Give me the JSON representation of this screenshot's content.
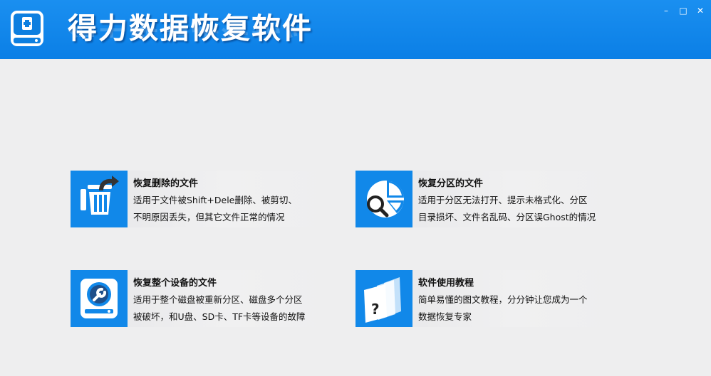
{
  "app": {
    "title": "得力数据恢复软件",
    "colors": {
      "header": "#0b7fe6",
      "icon_bg": "#1188e9",
      "background": "#eeeeef"
    }
  },
  "window_controls": {
    "minimize": "–",
    "maximize": "□",
    "close": "✕"
  },
  "options": [
    {
      "title": "恢复删除的文件",
      "desc_line1": "适用于文件被Shift+Dele删除、被剪切、",
      "desc_line2": "不明原因丢失，但其它文件正常的情况",
      "icon": "recycle-bin-restore-icon"
    },
    {
      "title": "恢复分区的文件",
      "desc_line1": "适用于分区无法打开、提示未格式化、分区",
      "desc_line2": "目录损坏、文件名乱码、分区误Ghost的情况",
      "icon": "partition-search-icon"
    },
    {
      "title": "恢复整个设备的文件",
      "desc_line1": "适用于整个磁盘被重新分区、磁盘多个分区",
      "desc_line2": "被破坏，和U盘、SD卡、TF卡等设备的故障",
      "icon": "disk-repair-icon"
    },
    {
      "title": "软件使用教程",
      "desc_line1": "简单易懂的图文教程，分分钟让您成为一个",
      "desc_line2": "数据恢复专家",
      "icon": "tutorial-help-icon"
    }
  ]
}
